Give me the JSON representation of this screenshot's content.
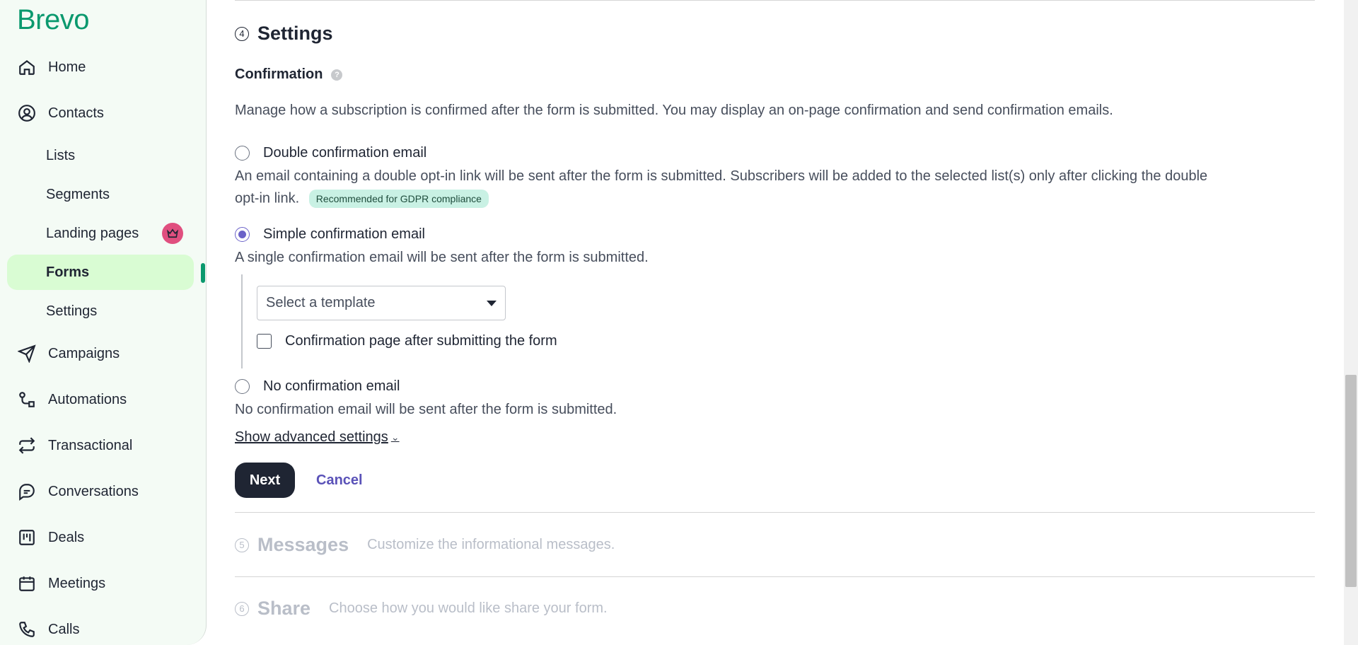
{
  "brand": {
    "name": "Brevo",
    "color": "#0b996e"
  },
  "sidebar": {
    "items": [
      {
        "label": "Home",
        "icon": "home-icon"
      },
      {
        "label": "Contacts",
        "icon": "contacts-icon"
      },
      {
        "label": "Lists"
      },
      {
        "label": "Segments"
      },
      {
        "label": "Landing pages",
        "badge_icon": "crown-icon"
      },
      {
        "label": "Forms",
        "active": true
      },
      {
        "label": "Settings"
      },
      {
        "label": "Campaigns",
        "icon": "send-icon"
      },
      {
        "label": "Automations",
        "icon": "automation-icon"
      },
      {
        "label": "Transactional",
        "icon": "repeat-icon"
      },
      {
        "label": "Conversations",
        "icon": "chat-icon"
      },
      {
        "label": "Deals",
        "icon": "kanban-icon"
      },
      {
        "label": "Meetings",
        "icon": "calendar-icon"
      },
      {
        "label": "Calls",
        "icon": "phone-icon"
      }
    ]
  },
  "settings_step": {
    "number": "4",
    "title": "Settings",
    "confirmation_label": "Confirmation",
    "help_glyph": "?",
    "description": "Manage how a subscription is confirmed after the form is submitted. You may display an on-page confirmation and send confirmation emails.",
    "options": [
      {
        "label": "Double confirmation email",
        "description_line1": "An email containing a double opt-in link will be sent after the form is submitted. Subscribers will be added to the selected list(s) only after clicking the double",
        "description_line2": "opt-in link.",
        "badge": "Recommended for GDPR compliance",
        "selected": false
      },
      {
        "label": "Simple confirmation email",
        "description": "A single confirmation email will be sent after the form is submitted.",
        "selected": true
      },
      {
        "label": "No confirmation email",
        "description": "No confirmation email will be sent after the form is submitted.",
        "selected": false
      }
    ],
    "template_select": {
      "value": "Select a template"
    },
    "confirmation_page_checkbox": {
      "label": "Confirmation page after submitting the form",
      "checked": false
    },
    "advanced_link": "Show advanced settings",
    "next_label": "Next",
    "cancel_label": "Cancel"
  },
  "messages_step": {
    "number": "5",
    "title": "Messages",
    "description": "Customize the informational messages."
  },
  "share_step": {
    "number": "6",
    "title": "Share",
    "description": "Choose how you would like share your form."
  },
  "colors": {
    "accent": "#6b62c8",
    "active_nav_bg": "#d9fcd3",
    "badge_bg": "#c9f1e4",
    "primary_button": "#1f2533"
  }
}
